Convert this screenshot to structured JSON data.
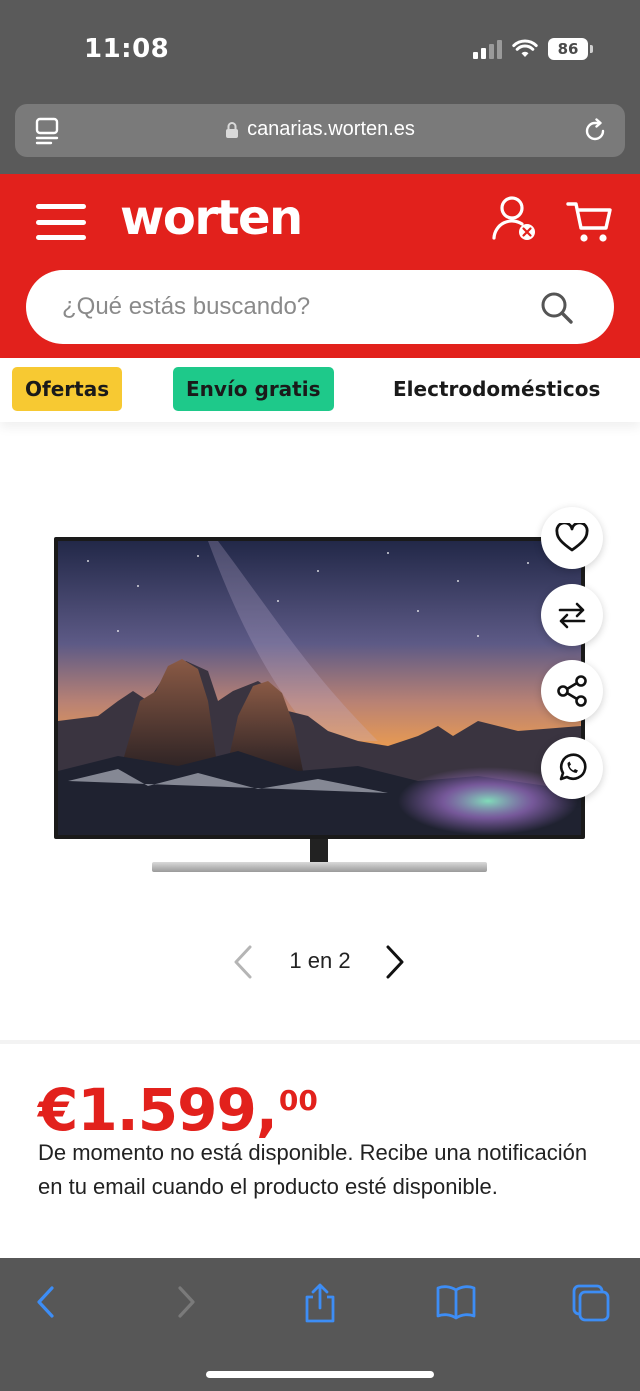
{
  "status_bar": {
    "time": "11:08",
    "battery": "86"
  },
  "browser": {
    "url": "canarias.worten.es",
    "reader_icon": "reader-icon",
    "lock_icon": "lock-icon",
    "reload_icon": "reload-icon"
  },
  "header": {
    "logo": "worten",
    "colors": {
      "brand_red": "#e2211c"
    },
    "search": {
      "placeholder": "¿Qué estás buscando?",
      "value": ""
    }
  },
  "chips": [
    {
      "label": "Ofertas",
      "color": "#f7c932"
    },
    {
      "label": "Envío gratis",
      "color": "#1ec98a"
    },
    {
      "label": "Electrodomésticos",
      "color": "#ffffff"
    }
  ],
  "product": {
    "actions": [
      "heart-icon",
      "compare-icon",
      "share-icon",
      "whatsapp-icon"
    ],
    "pager": {
      "text": "1 en 2",
      "current": 1,
      "total": 2
    },
    "price": {
      "main": "€1.599,",
      "cents": "00"
    },
    "availability": "De momento no está disponible. Recibe una notificación en tu email cuando el producto esté disponible."
  },
  "bottom_bar": {
    "icons": [
      "back-icon",
      "forward-icon",
      "share-sheet-icon",
      "bookmarks-icon",
      "tabs-icon"
    ]
  }
}
